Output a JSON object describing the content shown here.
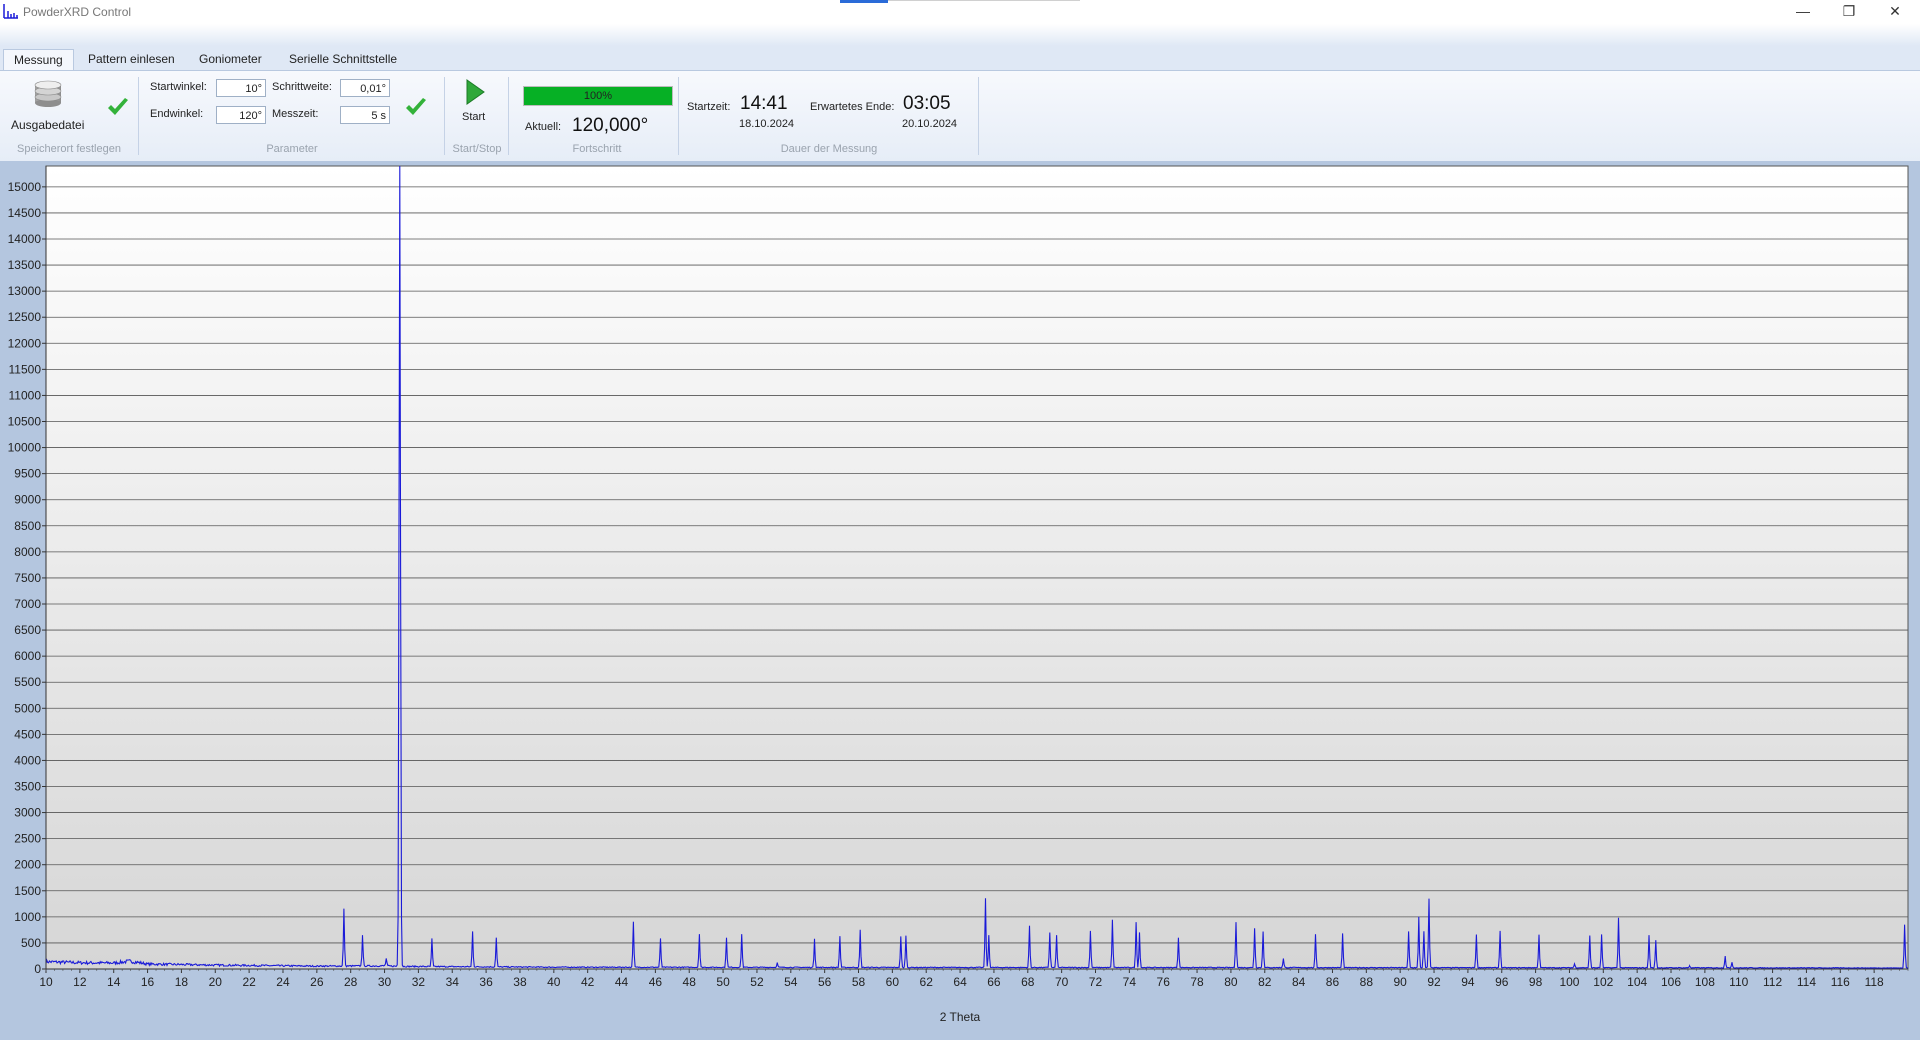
{
  "window": {
    "title": "PowderXRD Control",
    "app_icon": "chart-icon",
    "controls": [
      "minimize-icon",
      "restore-icon",
      "close-icon"
    ]
  },
  "tabs": [
    {
      "label": "Messung",
      "active": true
    },
    {
      "label": "Pattern einlesen",
      "active": false
    },
    {
      "label": "Goniometer",
      "active": false
    },
    {
      "label": "Serielle Schnittstelle",
      "active": false
    }
  ],
  "ribbon": {
    "storage": {
      "button_label": "Ausgabedatei",
      "icon": "database-icon",
      "status_icon": "check-icon",
      "group_label": "Speicherort festlegen"
    },
    "parameter": {
      "startwinkel_label": "Startwinkel:",
      "startwinkel_value": "10°",
      "endwinkel_label": "Endwinkel:",
      "endwinkel_value": "120°",
      "schrittweite_label": "Schrittweite:",
      "schrittweite_value": "0,01°",
      "messzeit_label": "Messzeit:",
      "messzeit_value": "5 s",
      "status_icon": "check-icon",
      "group_label": "Parameter"
    },
    "startstop": {
      "button_label": "Start",
      "icon": "play-icon",
      "group_label": "Start/Stop"
    },
    "progress": {
      "percent_text": "100%",
      "percent": 100,
      "current_label": "Aktuell:",
      "current_value": "120,000°",
      "group_label": "Fortschritt",
      "color": "#06b025"
    },
    "duration": {
      "start_label": "Startzeit:",
      "start_time": "14:41",
      "start_date": "18.10.2024",
      "end_label": "Erwartetes Ende:",
      "end_time": "03:05",
      "end_date": "20.10.2024",
      "group_label": "Dauer der Messung"
    }
  },
  "chart_data": {
    "type": "line",
    "title": "",
    "xlabel": "2 Theta",
    "ylabel": "",
    "xlim": [
      10,
      120
    ],
    "ylim": [
      0,
      15400
    ],
    "x_ticks": [
      10,
      12,
      14,
      16,
      18,
      20,
      22,
      24,
      26,
      28,
      30,
      32,
      34,
      36,
      38,
      40,
      42,
      44,
      46,
      48,
      50,
      52,
      54,
      56,
      58,
      60,
      62,
      64,
      66,
      68,
      70,
      72,
      74,
      76,
      78,
      80,
      82,
      84,
      86,
      88,
      90,
      92,
      94,
      96,
      98,
      100,
      102,
      104,
      106,
      108,
      110,
      112,
      114,
      116,
      118
    ],
    "y_ticks": [
      0,
      500,
      1000,
      1500,
      2000,
      2500,
      3000,
      3500,
      4000,
      4500,
      5000,
      5500,
      6000,
      6500,
      7000,
      7500,
      8000,
      8500,
      9000,
      9500,
      10000,
      10500,
      11000,
      11500,
      12000,
      12500,
      13000,
      13500,
      14000,
      14500,
      15000
    ],
    "grid": "horizontal",
    "line_color": "#1a1ad8",
    "series": [
      {
        "baseline": [
          [
            10,
            140
          ],
          [
            12,
            120
          ],
          [
            14,
            115
          ],
          [
            15,
            150
          ],
          [
            16,
            95
          ],
          [
            20,
            75
          ],
          [
            26,
            55
          ],
          [
            30,
            60
          ],
          [
            31,
            50
          ],
          [
            40,
            35
          ],
          [
            60,
            30
          ],
          [
            80,
            28
          ],
          [
            100,
            25
          ],
          [
            120,
            20
          ]
        ],
        "peaks": [
          [
            26.3,
            60
          ],
          [
            27.6,
            1150
          ],
          [
            28.7,
            650
          ],
          [
            30.1,
            200
          ],
          [
            30.9,
            15400
          ],
          [
            32.8,
            580
          ],
          [
            35.2,
            720
          ],
          [
            36.6,
            600
          ],
          [
            44.7,
            900
          ],
          [
            46.3,
            580
          ],
          [
            48.6,
            670
          ],
          [
            50.2,
            600
          ],
          [
            51.1,
            670
          ],
          [
            53.2,
            120
          ],
          [
            55.4,
            580
          ],
          [
            56.9,
            630
          ],
          [
            58.1,
            750
          ],
          [
            60.5,
            620
          ],
          [
            60.8,
            640
          ],
          [
            65.5,
            1350
          ],
          [
            65.7,
            650
          ],
          [
            68.1,
            830
          ],
          [
            69.3,
            700
          ],
          [
            69.7,
            650
          ],
          [
            71.7,
            730
          ],
          [
            73.0,
            940
          ],
          [
            74.4,
            900
          ],
          [
            74.6,
            700
          ],
          [
            76.9,
            600
          ],
          [
            80.3,
            900
          ],
          [
            81.4,
            780
          ],
          [
            81.9,
            720
          ],
          [
            83.1,
            200
          ],
          [
            85.0,
            660
          ],
          [
            86.6,
            680
          ],
          [
            90.5,
            720
          ],
          [
            91.1,
            1000
          ],
          [
            91.4,
            720
          ],
          [
            91.7,
            1350
          ],
          [
            94.5,
            660
          ],
          [
            95.9,
            730
          ],
          [
            98.2,
            660
          ],
          [
            100.3,
            100
          ],
          [
            101.2,
            640
          ],
          [
            101.9,
            660
          ],
          [
            102.9,
            980
          ],
          [
            104.7,
            650
          ],
          [
            105.1,
            550
          ],
          [
            107.1,
            60
          ],
          [
            109.2,
            250
          ],
          [
            109.6,
            130
          ],
          [
            119.8,
            850
          ]
        ]
      }
    ]
  }
}
